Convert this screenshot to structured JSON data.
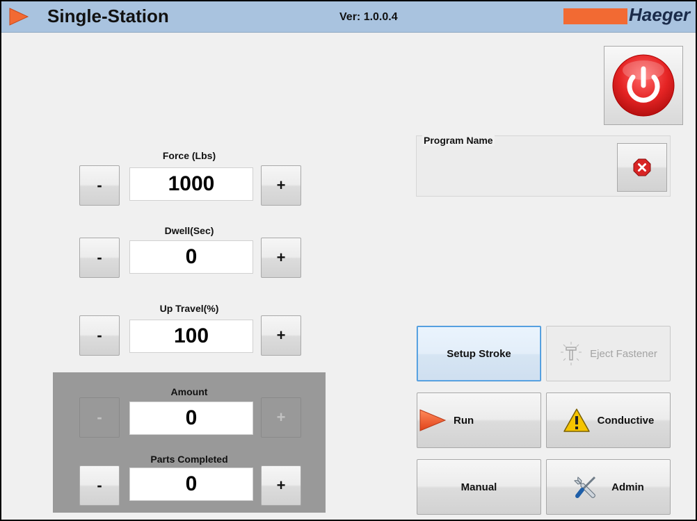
{
  "header": {
    "title": "Single-Station",
    "version": "Ver: 1.0.0.4",
    "brand": "Haeger",
    "brand_color": "#f26a33",
    "titlebar_color": "#a9c3df"
  },
  "controls": {
    "force": {
      "label": "Force (Lbs)",
      "value": "1000",
      "minus": "-",
      "plus": "+"
    },
    "dwell": {
      "label": "Dwell(Sec)",
      "value": "0",
      "minus": "-",
      "plus": "+"
    },
    "up_travel": {
      "label": "Up Travel(%)",
      "value": "100",
      "minus": "-",
      "plus": "+"
    },
    "amount": {
      "label": "Amount",
      "value": "0",
      "minus": "-",
      "plus": "+",
      "enabled": false
    },
    "parts_completed": {
      "label": "Parts Completed",
      "value": "0",
      "minus": "-",
      "plus": "+"
    }
  },
  "program": {
    "label": "Program Name",
    "value": "",
    "clear_icon": "red-stop-x-icon"
  },
  "power_icon": "power-icon",
  "buttons": {
    "setup_stroke": "Setup Stroke",
    "eject_fastener": "Eject Fastener",
    "run": "Run",
    "conductive": "Conductive",
    "manual": "Manual",
    "admin": "Admin"
  },
  "icons": {
    "run": "play-arrow-icon",
    "conductive": "warning-icon",
    "admin": "wrench-screwdriver-icon",
    "eject": "fastener-icon"
  }
}
